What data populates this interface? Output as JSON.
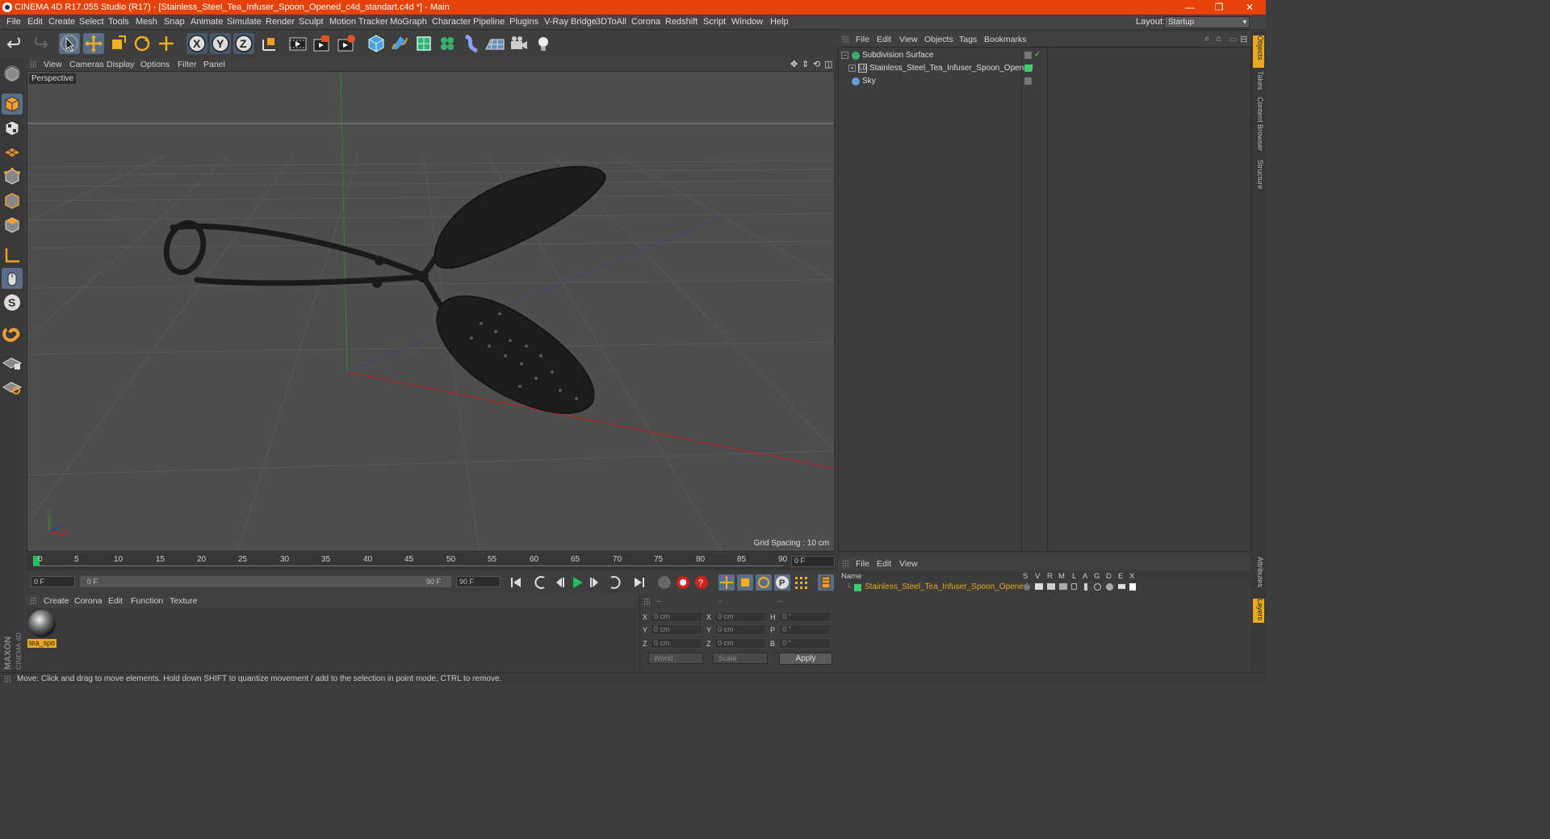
{
  "window": {
    "title": "CINEMA 4D R17.055 Studio (R17) - [Stainless_Steel_Tea_Infuser_Spoon_Opened_c4d_standart.c4d *] - Main",
    "minimize": "—",
    "maximize": "❐",
    "close": "✕"
  },
  "menubar": {
    "items": [
      "File",
      "Edit",
      "Create",
      "Select",
      "Tools",
      "Mesh",
      "Snap",
      "Animate",
      "Simulate",
      "Render",
      "Sculpt",
      "Motion Tracker",
      "MoGraph",
      "Character",
      "Pipeline",
      "Plugins",
      "V-Ray Bridge",
      "3DToAll",
      "Corona",
      "Redshift",
      "Script",
      "Window",
      "Help"
    ],
    "layout_label": "Layout:",
    "layout_value": "Startup"
  },
  "toolbar": {
    "icons": [
      "undo-icon",
      "redo-icon",
      "select-icon",
      "move-icon",
      "scale-icon",
      "rotate-icon",
      "last-tool-icon",
      "x-axis-icon",
      "y-axis-icon",
      "z-axis-icon",
      "coordinate-system-icon",
      "render-view-icon",
      "render-picture-viewer-icon",
      "edit-render-settings-icon",
      "cube-icon",
      "pen-spline-icon",
      "subdivision-icon",
      "cloner-icon",
      "deformer-icon",
      "floor-icon",
      "camera-icon",
      "light-icon"
    ],
    "axis_x": "X",
    "axis_y": "Y",
    "axis_z": "Z"
  },
  "viewport": {
    "menu": [
      "View",
      "Cameras",
      "Display",
      "Options",
      "Filter",
      "Panel"
    ],
    "label": "Perspective",
    "grid_spacing": "Grid Spacing : 10 cm"
  },
  "timeline": {
    "ticks": [
      "0",
      "5",
      "10",
      "15",
      "20",
      "25",
      "30",
      "35",
      "40",
      "45",
      "50",
      "55",
      "60",
      "65",
      "70",
      "75",
      "80",
      "85",
      "90"
    ],
    "current_frame": "0 F",
    "start_field": "0 F",
    "range_start": "0 F",
    "range_end": "90 F",
    "end_field": "90 F"
  },
  "materials": {
    "menu": [
      "Create",
      "Corona",
      "Edit",
      "Function",
      "Texture"
    ],
    "items": [
      {
        "name": "tea_spo"
      }
    ]
  },
  "coordinates": {
    "header": [
      "--",
      "--",
      "--"
    ],
    "rows": [
      {
        "l1": "X",
        "v1": "0 cm",
        "l2": "X",
        "v2": "0 cm",
        "l3": "H",
        "v3": "0 °"
      },
      {
        "l1": "Y",
        "v1": "0 cm",
        "l2": "Y",
        "v2": "0 cm",
        "l3": "P",
        "v3": "0 °"
      },
      {
        "l1": "Z",
        "v1": "0 cm",
        "l2": "Z",
        "v2": "0 cm",
        "l3": "B",
        "v3": "0 °"
      }
    ],
    "mode": "World",
    "transform": "Scale",
    "apply": "Apply"
  },
  "status": {
    "text": "Move: Click and drag to move elements. Hold down SHIFT to quantize movement / add to the selection in point mode, CTRL to remove."
  },
  "object_manager": {
    "menu": [
      "File",
      "Edit",
      "View",
      "Objects",
      "Tags",
      "Bookmarks"
    ],
    "objects": [
      {
        "name": "Subdivision Surface",
        "color": "#5fbf5f"
      },
      {
        "name": "Stainless_Steel_Tea_Infuser_Spoon_Opened",
        "color": "#6fd86f"
      },
      {
        "name": "Sky",
        "color": "#6a9ad8"
      }
    ]
  },
  "layer_manager": {
    "menu": [
      "File",
      "Edit",
      "View"
    ],
    "columns": [
      "Name",
      "S",
      "V",
      "R",
      "M",
      "L",
      "A",
      "G",
      "D",
      "E",
      "X"
    ],
    "layers": [
      {
        "name": "Stainless_Steel_Tea_Infuser_Spoon_Opened",
        "color": "#e8a820"
      }
    ]
  },
  "side_tabs": [
    "Objects",
    "Takes",
    "Content Browser",
    "Structure",
    "Attributes",
    "Layers"
  ],
  "brand": {
    "maxon": "MAXON",
    "product": "CINEMA 4D"
  },
  "colors": {
    "accent": "#e8420c",
    "selection": "#e8a820",
    "highlight": "#5b6e87"
  }
}
